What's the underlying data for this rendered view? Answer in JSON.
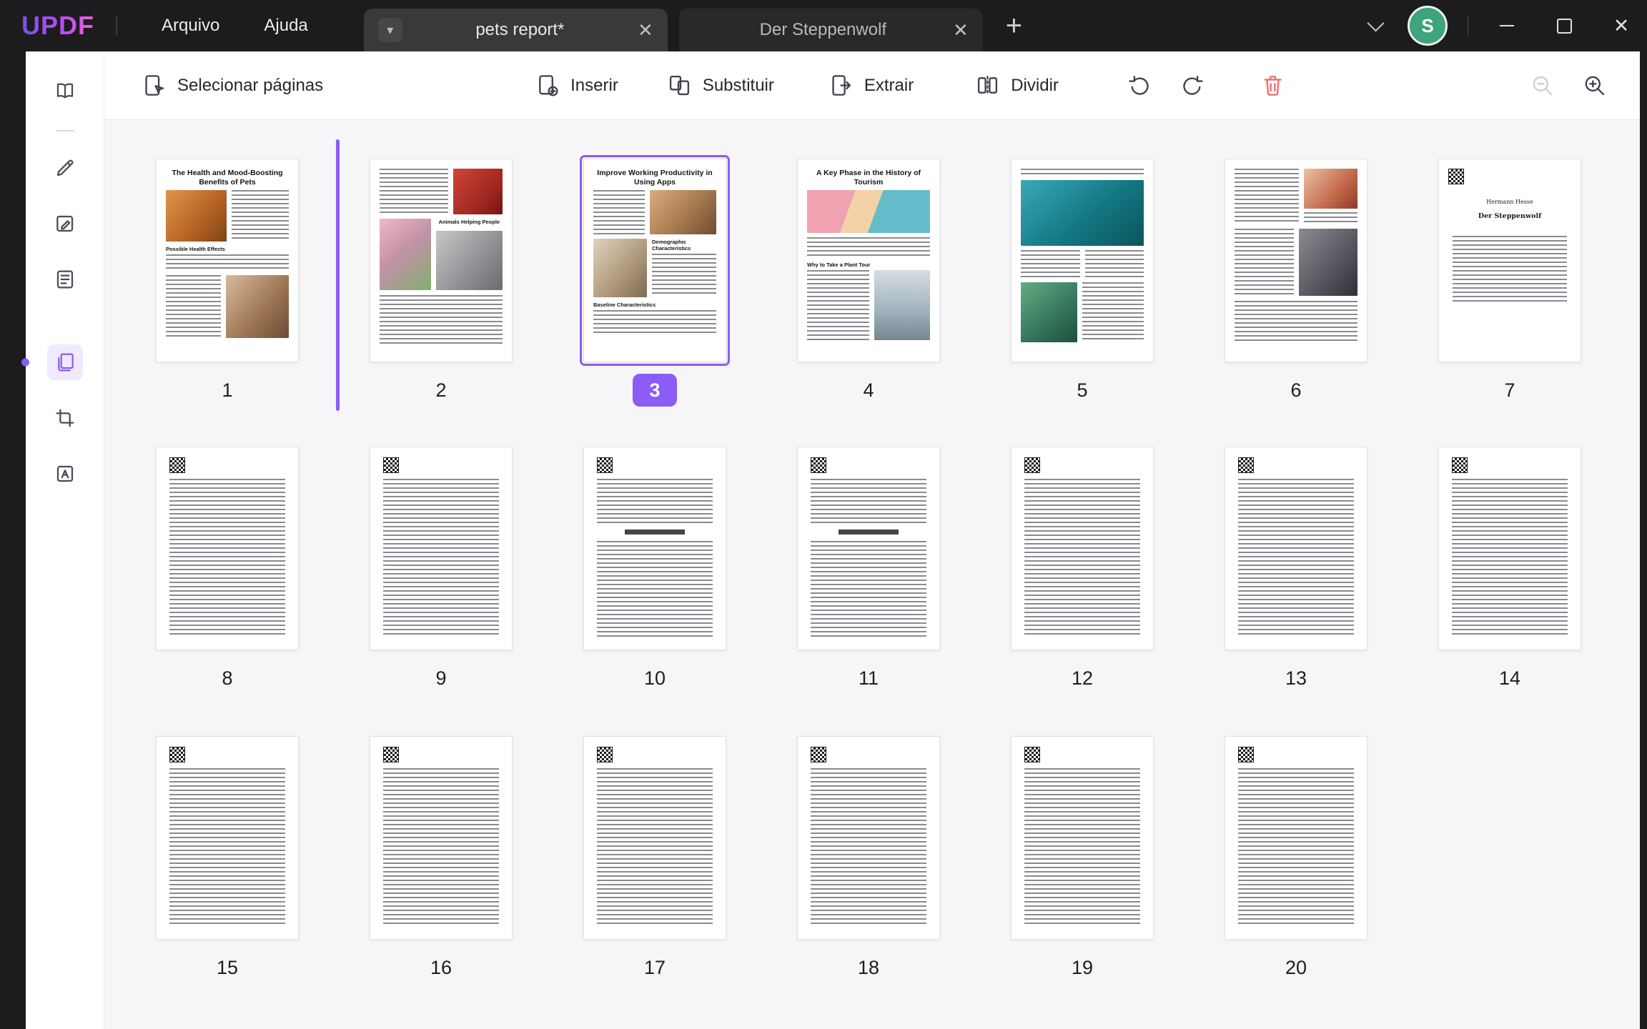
{
  "app": {
    "logo": "UPDF",
    "menu": {
      "file": "Arquivo",
      "help": "Ajuda"
    },
    "tabs": [
      {
        "label": "pets report*",
        "active": true
      },
      {
        "label": "Der Steppenwolf",
        "active": false
      }
    ],
    "avatar_initial": "S"
  },
  "icons": {
    "tab_dropdown": "▾",
    "close_tab": "✕",
    "add_tab": "+",
    "close_window": "✕"
  },
  "toolbar": {
    "select_pages": "Selecionar páginas",
    "insert": "Inserir",
    "replace": "Substituir",
    "extract": "Extrair",
    "split": "Dividir"
  },
  "sidebar": {
    "items": [
      "reader",
      "annotate",
      "edit",
      "form",
      "organize-pages",
      "crop",
      "ocr"
    ],
    "active_item": "organize-pages"
  },
  "organize": {
    "selected_page": "3",
    "insert_marker_after_page": "1"
  },
  "colors": {
    "accent": "#8B5CF6",
    "danger": "#EE6A6A",
    "avatar_bg": "#3EA47B"
  },
  "pages": [
    {
      "num": "1",
      "kind": "pets",
      "title": "The Health and Mood-Boosting Benefits of Pets",
      "subhead": "Possible Health Effects"
    },
    {
      "num": "2",
      "kind": "animals",
      "heading": "Animals Helping People"
    },
    {
      "num": "3",
      "kind": "productivity",
      "title": "Improve Working Productivity in Using Apps",
      "subhead1": "Demographic Characteristics",
      "subhead2": "Baseline Characteristics",
      "selected": true
    },
    {
      "num": "4",
      "kind": "tourism",
      "title": "A Key Phase in the History of Tourism",
      "subhead": "Why to Take a Plant Tour"
    },
    {
      "num": "5",
      "kind": "lake"
    },
    {
      "num": "6",
      "kind": "women"
    },
    {
      "num": "7",
      "kind": "booktitle",
      "author": "Hermann Hesse",
      "book": "Der Steppenwolf"
    },
    {
      "num": "8",
      "kind": "text"
    },
    {
      "num": "9",
      "kind": "text"
    },
    {
      "num": "10",
      "kind": "text",
      "mid_break": true
    },
    {
      "num": "11",
      "kind": "text",
      "mid_break": true
    },
    {
      "num": "12",
      "kind": "text"
    },
    {
      "num": "13",
      "kind": "text"
    },
    {
      "num": "14",
      "kind": "text"
    },
    {
      "num": "15",
      "kind": "text"
    },
    {
      "num": "16",
      "kind": "text"
    },
    {
      "num": "17",
      "kind": "text"
    },
    {
      "num": "18",
      "kind": "text"
    },
    {
      "num": "19",
      "kind": "text"
    },
    {
      "num": "20",
      "kind": "text"
    }
  ]
}
